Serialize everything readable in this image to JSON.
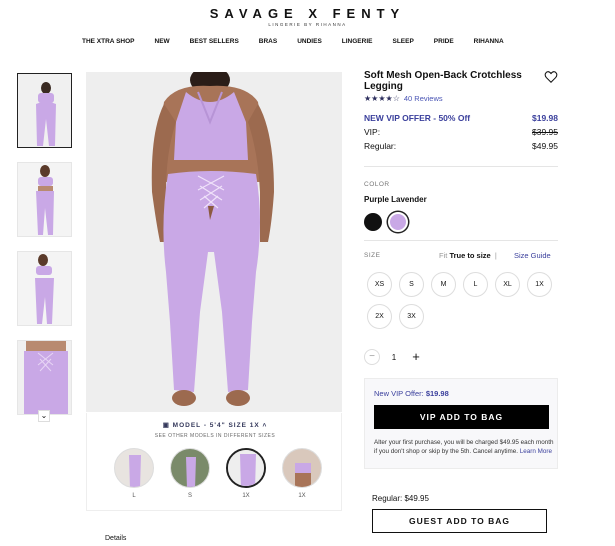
{
  "brand": {
    "name": "SAVAGE X FENTY",
    "tagline": "LINGERIE BY RIHANNA"
  },
  "nav": [
    "THE XTRA SHOP",
    "NEW",
    "BEST SELLERS",
    "BRAS",
    "UNDIES",
    "LINGERIE",
    "SLEEP",
    "PRIDE",
    "RIHANNA"
  ],
  "product": {
    "title": "Soft Mesh Open-Back Crotchless Legging",
    "stars": "★★★★☆",
    "reviews": "40 Reviews",
    "vip_offer_label": "NEW VIP OFFER - 50% Off",
    "vip_offer_price": "$19.98",
    "vip_label": "VIP:",
    "vip_price": "$39.95",
    "regular_label": "Regular:",
    "regular_price": "$49.95"
  },
  "color": {
    "heading": "COLOR",
    "selected": "Purple Lavender",
    "swatches": [
      "#111111",
      "#c9a8e6"
    ]
  },
  "size": {
    "heading": "SIZE",
    "fit_label": "Fit",
    "fit_value": "True to size",
    "guide": "Size Guide",
    "options": [
      "XS",
      "S",
      "M",
      "L",
      "XL",
      "1X",
      "2X",
      "3X"
    ]
  },
  "quantity": {
    "minus": "−",
    "value": "1",
    "plus": "+"
  },
  "vip_box": {
    "title_prefix": "New VIP Offer: ",
    "title_price": "$19.98",
    "button": "VIP ADD TO BAG",
    "note": "Alter your first purchase, you will be charged $49.95 each month if you don't shop or skip by the 5th. Cancel anytime. ",
    "learn_more": "Learn More"
  },
  "guest": {
    "regular_label": "Regular:",
    "regular_price": "$49.95",
    "button": "GUEST ADD TO BAG"
  },
  "model": {
    "info": "MODEL - 5'4\" SIZE 1X",
    "sub": "SEE OTHER MODELS IN DIFFERENT SIZES",
    "options": [
      "L",
      "S",
      "1X",
      "1X"
    ]
  },
  "details": "Details",
  "accent_color": "#3a3f9c",
  "product_color": "#c9a8e6"
}
